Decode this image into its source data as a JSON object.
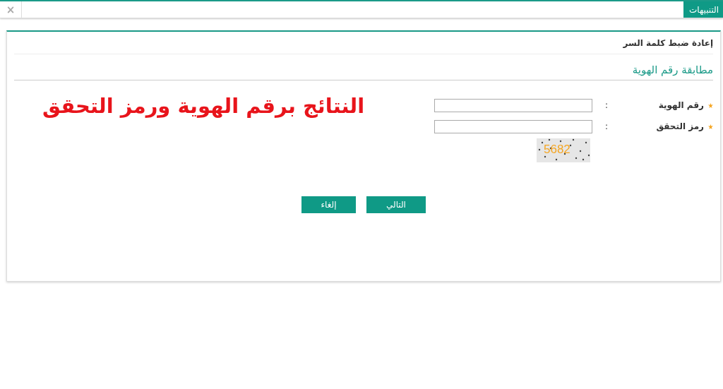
{
  "top_bar": {
    "tab": "التنبيهات",
    "close": "×"
  },
  "card": {
    "heading": "إعادة ضبط كلمة السر",
    "section_title": "مطابقة رقم الهوية",
    "fields": [
      {
        "label": "رقم الهوية",
        "required": true,
        "colon": ":"
      },
      {
        "label": "رمز التحقق",
        "required": true,
        "colon": ":"
      }
    ],
    "captcha": "5682",
    "annotation": "النتائج برقم الهوية ورمز التحقق",
    "buttons": [
      "التالي",
      "إلغاء"
    ]
  }
}
